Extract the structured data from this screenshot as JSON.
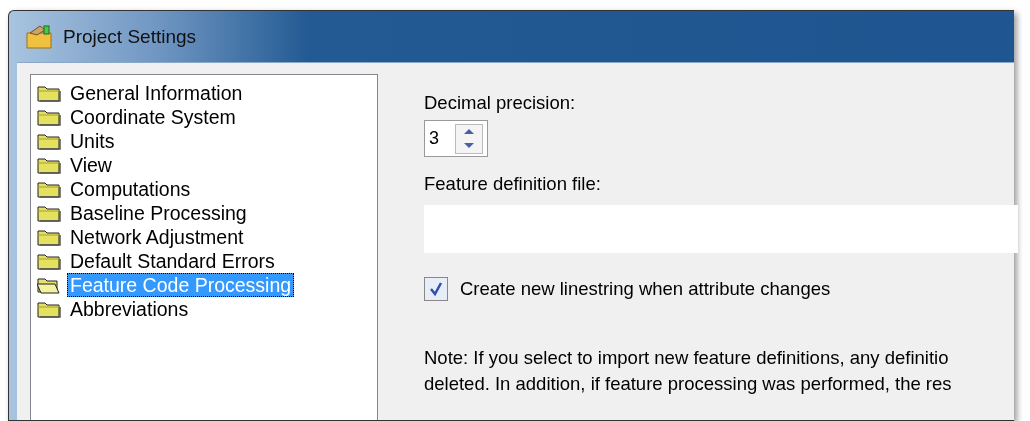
{
  "window": {
    "title": "Project Settings"
  },
  "sidebar": {
    "items": [
      {
        "label": "General Information",
        "selected": false
      },
      {
        "label": "Coordinate System",
        "selected": false
      },
      {
        "label": "Units",
        "selected": false
      },
      {
        "label": "View",
        "selected": false
      },
      {
        "label": "Computations",
        "selected": false
      },
      {
        "label": "Baseline Processing",
        "selected": false
      },
      {
        "label": "Network Adjustment",
        "selected": false
      },
      {
        "label": "Default Standard Errors",
        "selected": false
      },
      {
        "label": "Feature Code Processing",
        "selected": true
      },
      {
        "label": "Abbreviations",
        "selected": false
      }
    ]
  },
  "settings": {
    "precision_label": "Decimal precision:",
    "precision_value": "3",
    "file_label": "Feature definition file:",
    "checkbox": {
      "label": "Create new linestring when attribute changes",
      "checked": true
    },
    "note": [
      "Note: If you select to import new feature definitions, any definitio",
      "deleted. In addition, if feature processing was performed, the res"
    ]
  }
}
